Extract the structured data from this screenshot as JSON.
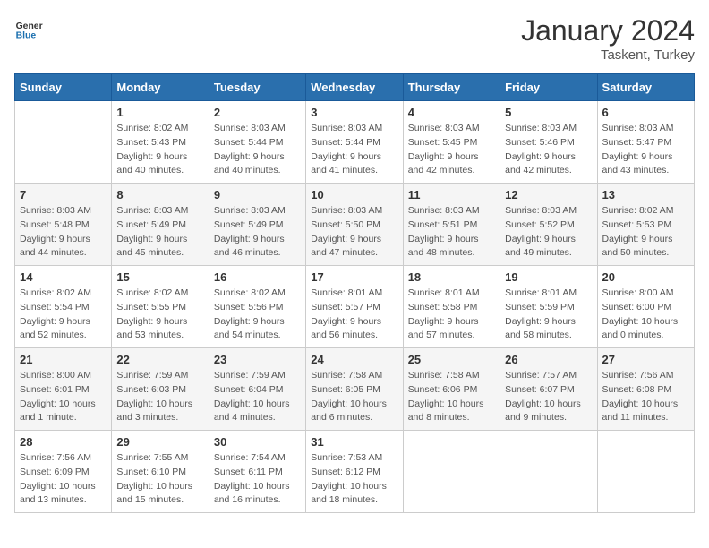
{
  "logo": {
    "general": "General",
    "blue": "Blue"
  },
  "title": {
    "month_year": "January 2024",
    "location": "Taskent, Turkey"
  },
  "weekdays": [
    "Sunday",
    "Monday",
    "Tuesday",
    "Wednesday",
    "Thursday",
    "Friday",
    "Saturday"
  ],
  "weeks": [
    [
      {
        "day": "",
        "info": ""
      },
      {
        "day": "1",
        "info": "Sunrise: 8:02 AM\nSunset: 5:43 PM\nDaylight: 9 hours\nand 40 minutes."
      },
      {
        "day": "2",
        "info": "Sunrise: 8:03 AM\nSunset: 5:44 PM\nDaylight: 9 hours\nand 40 minutes."
      },
      {
        "day": "3",
        "info": "Sunrise: 8:03 AM\nSunset: 5:44 PM\nDaylight: 9 hours\nand 41 minutes."
      },
      {
        "day": "4",
        "info": "Sunrise: 8:03 AM\nSunset: 5:45 PM\nDaylight: 9 hours\nand 42 minutes."
      },
      {
        "day": "5",
        "info": "Sunrise: 8:03 AM\nSunset: 5:46 PM\nDaylight: 9 hours\nand 42 minutes."
      },
      {
        "day": "6",
        "info": "Sunrise: 8:03 AM\nSunset: 5:47 PM\nDaylight: 9 hours\nand 43 minutes."
      }
    ],
    [
      {
        "day": "7",
        "info": "Sunrise: 8:03 AM\nSunset: 5:48 PM\nDaylight: 9 hours\nand 44 minutes."
      },
      {
        "day": "8",
        "info": "Sunrise: 8:03 AM\nSunset: 5:49 PM\nDaylight: 9 hours\nand 45 minutes."
      },
      {
        "day": "9",
        "info": "Sunrise: 8:03 AM\nSunset: 5:49 PM\nDaylight: 9 hours\nand 46 minutes."
      },
      {
        "day": "10",
        "info": "Sunrise: 8:03 AM\nSunset: 5:50 PM\nDaylight: 9 hours\nand 47 minutes."
      },
      {
        "day": "11",
        "info": "Sunrise: 8:03 AM\nSunset: 5:51 PM\nDaylight: 9 hours\nand 48 minutes."
      },
      {
        "day": "12",
        "info": "Sunrise: 8:03 AM\nSunset: 5:52 PM\nDaylight: 9 hours\nand 49 minutes."
      },
      {
        "day": "13",
        "info": "Sunrise: 8:02 AM\nSunset: 5:53 PM\nDaylight: 9 hours\nand 50 minutes."
      }
    ],
    [
      {
        "day": "14",
        "info": "Sunrise: 8:02 AM\nSunset: 5:54 PM\nDaylight: 9 hours\nand 52 minutes."
      },
      {
        "day": "15",
        "info": "Sunrise: 8:02 AM\nSunset: 5:55 PM\nDaylight: 9 hours\nand 53 minutes."
      },
      {
        "day": "16",
        "info": "Sunrise: 8:02 AM\nSunset: 5:56 PM\nDaylight: 9 hours\nand 54 minutes."
      },
      {
        "day": "17",
        "info": "Sunrise: 8:01 AM\nSunset: 5:57 PM\nDaylight: 9 hours\nand 56 minutes."
      },
      {
        "day": "18",
        "info": "Sunrise: 8:01 AM\nSunset: 5:58 PM\nDaylight: 9 hours\nand 57 minutes."
      },
      {
        "day": "19",
        "info": "Sunrise: 8:01 AM\nSunset: 5:59 PM\nDaylight: 9 hours\nand 58 minutes."
      },
      {
        "day": "20",
        "info": "Sunrise: 8:00 AM\nSunset: 6:00 PM\nDaylight: 10 hours\nand 0 minutes."
      }
    ],
    [
      {
        "day": "21",
        "info": "Sunrise: 8:00 AM\nSunset: 6:01 PM\nDaylight: 10 hours\nand 1 minute."
      },
      {
        "day": "22",
        "info": "Sunrise: 7:59 AM\nSunset: 6:03 PM\nDaylight: 10 hours\nand 3 minutes."
      },
      {
        "day": "23",
        "info": "Sunrise: 7:59 AM\nSunset: 6:04 PM\nDaylight: 10 hours\nand 4 minutes."
      },
      {
        "day": "24",
        "info": "Sunrise: 7:58 AM\nSunset: 6:05 PM\nDaylight: 10 hours\nand 6 minutes."
      },
      {
        "day": "25",
        "info": "Sunrise: 7:58 AM\nSunset: 6:06 PM\nDaylight: 10 hours\nand 8 minutes."
      },
      {
        "day": "26",
        "info": "Sunrise: 7:57 AM\nSunset: 6:07 PM\nDaylight: 10 hours\nand 9 minutes."
      },
      {
        "day": "27",
        "info": "Sunrise: 7:56 AM\nSunset: 6:08 PM\nDaylight: 10 hours\nand 11 minutes."
      }
    ],
    [
      {
        "day": "28",
        "info": "Sunrise: 7:56 AM\nSunset: 6:09 PM\nDaylight: 10 hours\nand 13 minutes."
      },
      {
        "day": "29",
        "info": "Sunrise: 7:55 AM\nSunset: 6:10 PM\nDaylight: 10 hours\nand 15 minutes."
      },
      {
        "day": "30",
        "info": "Sunrise: 7:54 AM\nSunset: 6:11 PM\nDaylight: 10 hours\nand 16 minutes."
      },
      {
        "day": "31",
        "info": "Sunrise: 7:53 AM\nSunset: 6:12 PM\nDaylight: 10 hours\nand 18 minutes."
      },
      {
        "day": "",
        "info": ""
      },
      {
        "day": "",
        "info": ""
      },
      {
        "day": "",
        "info": ""
      }
    ]
  ]
}
